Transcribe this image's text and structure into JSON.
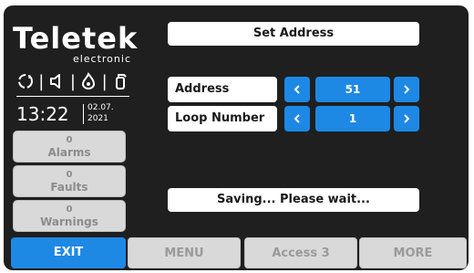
{
  "brand": {
    "name": "Teletek",
    "subtitle": "electronic"
  },
  "status_icons": [
    "sync-icon",
    "speaker-icon",
    "flame-icon",
    "extinguisher-icon"
  ],
  "clock": {
    "time": "13:22",
    "date_day": "02.07.",
    "date_year": "2021"
  },
  "counters": [
    {
      "count": "0",
      "label": "Alarms"
    },
    {
      "count": "0",
      "label": "Faults"
    },
    {
      "count": "0",
      "label": "Warnings"
    }
  ],
  "screen_title": "Set Address",
  "fields": [
    {
      "label": "Address",
      "value": "51"
    },
    {
      "label": "Loop Number",
      "value": "1"
    }
  ],
  "status_message": "Saving... Please wait...",
  "bottom_bar": {
    "exit": "EXIT",
    "menu": "MENU",
    "access": "Access 3",
    "more": "MORE"
  },
  "colors": {
    "accent": "#1e88e5",
    "panel_bg": "#1f1f1f",
    "disabled_bg": "#d9d9d9",
    "disabled_text": "#9a9a9a"
  }
}
